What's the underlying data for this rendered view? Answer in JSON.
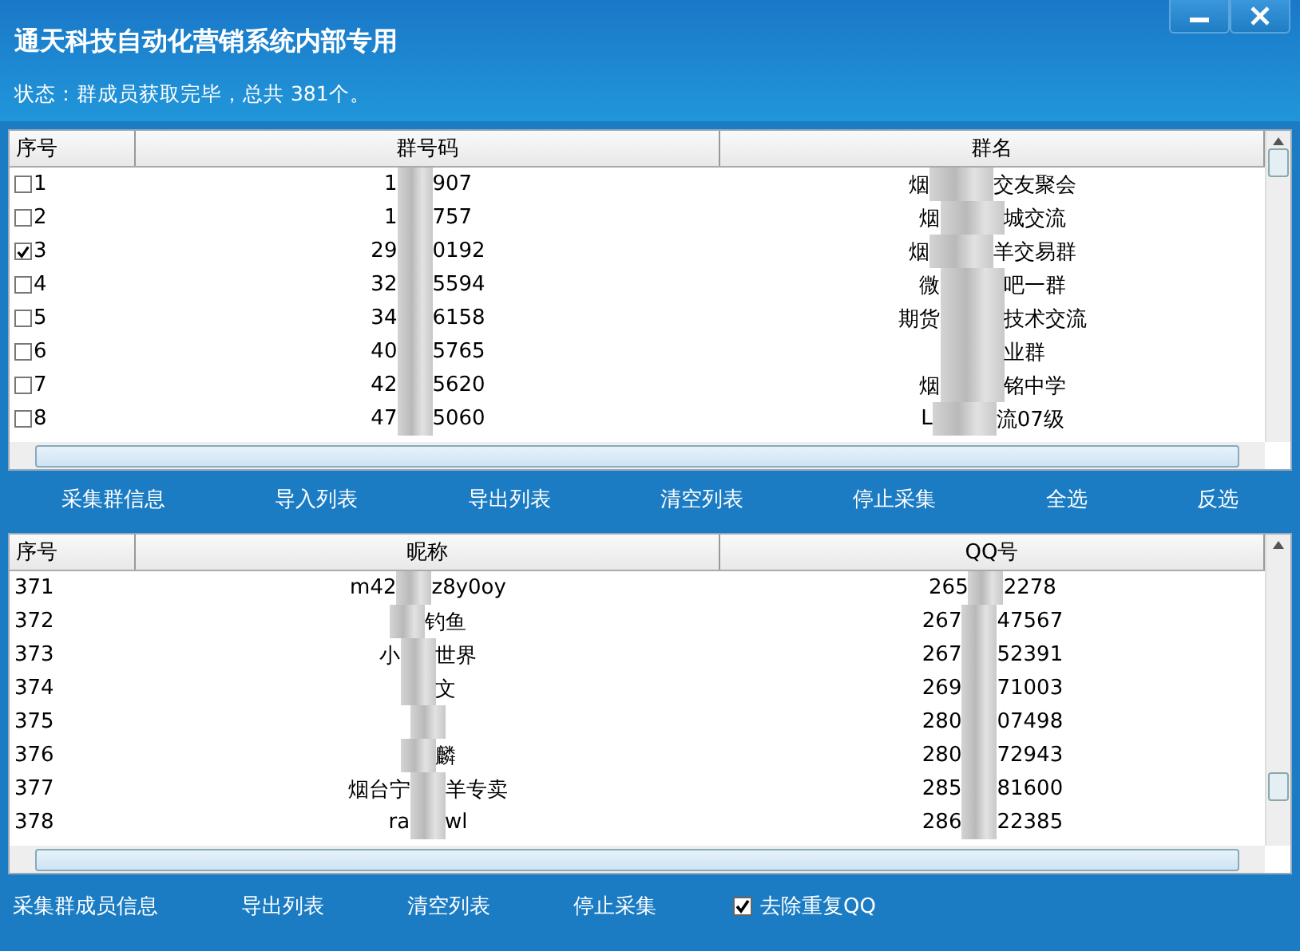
{
  "window": {
    "title": "通天科技自动化营销系统内部专用",
    "status": "状态：群成员获取完毕，总共 381个。",
    "controls": [
      {
        "kind": "minimize"
      },
      {
        "kind": "close"
      }
    ]
  },
  "group_table": {
    "columns": [
      "序号",
      "群号码",
      "群名"
    ],
    "rows": [
      {
        "checked": false,
        "no": "1",
        "code": {
          "before": "1",
          "after": "907"
        },
        "name": {
          "before": "烟",
          "after": "交友聚会"
        }
      },
      {
        "checked": false,
        "no": "2",
        "code": {
          "before": "1",
          "after": "757"
        },
        "name": {
          "before": "烟",
          "after": "城交流"
        }
      },
      {
        "checked": true,
        "no": "3",
        "code": {
          "before": "29",
          "after": "0192"
        },
        "name": {
          "before": "烟",
          "after": "羊交易群"
        }
      },
      {
        "checked": false,
        "no": "4",
        "code": {
          "before": "32",
          "after": "5594"
        },
        "name": {
          "before": "微",
          "after": "吧一群"
        }
      },
      {
        "checked": false,
        "no": "5",
        "code": {
          "before": "34",
          "after": "6158"
        },
        "name": {
          "before": "期货",
          "after": "技术交流"
        }
      },
      {
        "checked": false,
        "no": "6",
        "code": {
          "before": "40",
          "after": "5765"
        },
        "name": {
          "after": "业群"
        }
      },
      {
        "checked": false,
        "no": "7",
        "code": {
          "before": "42",
          "after": "5620"
        },
        "name": {
          "before": "烟",
          "after": "铭中学"
        }
      },
      {
        "checked": false,
        "no": "8",
        "code": {
          "before": "47",
          "after": "5060"
        },
        "name": {
          "before": "L",
          "after": "流07级"
        }
      }
    ]
  },
  "group_toolbar": [
    "采集群信息",
    "导入列表",
    "导出列表",
    "清空列表",
    "停止采集",
    "全选",
    "反选"
  ],
  "member_table": {
    "columns": [
      "序号",
      "昵称",
      "QQ号"
    ],
    "rows": [
      {
        "no": "371",
        "nick": {
          "before": "m42",
          "after": "z8y0oy"
        },
        "qq": {
          "before": "265",
          "after": "2278"
        }
      },
      {
        "no": "372",
        "nick": {
          "after": "钓鱼"
        },
        "qq": {
          "before": "267",
          "after": "47567"
        }
      },
      {
        "no": "373",
        "nick": {
          "before": "小",
          "after": "世界"
        },
        "qq": {
          "before": "267",
          "after": "52391"
        }
      },
      {
        "no": "374",
        "nick": {
          "after": "文"
        },
        "qq": {
          "before": "269",
          "after": "71003"
        }
      },
      {
        "no": "375",
        "nick": {},
        "qq": {
          "before": "280",
          "after": "07498"
        }
      },
      {
        "no": "376",
        "nick": {
          "after": "麟"
        },
        "qq": {
          "before": "280",
          "after": "72943"
        }
      },
      {
        "no": "377",
        "nick": {
          "before": "烟台宁",
          "after": "羊专卖"
        },
        "qq": {
          "before": "285",
          "after": "81600"
        }
      },
      {
        "no": "378",
        "nick": {
          "before": "ra",
          "after": "wl"
        },
        "qq": {
          "before": "286",
          "after": "22385"
        }
      }
    ]
  },
  "member_toolbar": {
    "buttons": [
      "采集群成员信息",
      "导出列表",
      "清空列表",
      "停止采集"
    ],
    "dedupe": {
      "label": "去除重复QQ",
      "checked": true
    }
  }
}
